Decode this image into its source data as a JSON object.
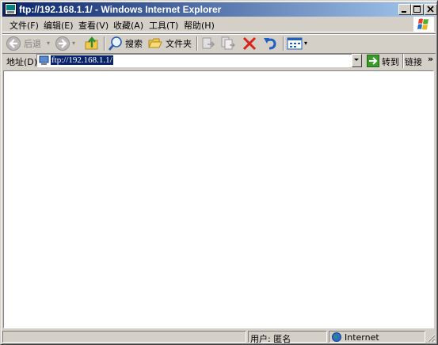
{
  "window": {
    "title": "ftp://192.168.1.1/ - Windows Internet Explorer"
  },
  "menubar": {
    "items": [
      "文件(F)",
      "编辑(E)",
      "查看(V)",
      "收藏(A)",
      "工具(T)",
      "帮助(H)"
    ]
  },
  "toolbar": {
    "back_label": "后退",
    "search_label": "搜索",
    "folders_label": "文件夹"
  },
  "addressbar": {
    "label": "地址(D)",
    "value": "ftp://192.168.1.1/",
    "go_label": "转到",
    "links_label": "链接",
    "chevron": "»"
  },
  "statusbar": {
    "user_label": "用户: 匿名",
    "zone_label": "Internet"
  },
  "colors": {
    "title_gradient_start": "#0a246a",
    "title_gradient_end": "#a6caf0",
    "chrome": "#d4d0c8",
    "selection": "#0a246a"
  },
  "icons": [
    "ie-page-icon",
    "minimize-icon",
    "maximize-icon",
    "close-icon",
    "windows-flag-icon",
    "back-arrow-icon",
    "forward-arrow-icon",
    "up-folder-icon",
    "search-magnifier-icon",
    "folders-icon",
    "move-to-icon",
    "copy-to-icon",
    "delete-icon",
    "undo-icon",
    "views-icon",
    "go-arrow-icon",
    "internet-globe-icon"
  ]
}
